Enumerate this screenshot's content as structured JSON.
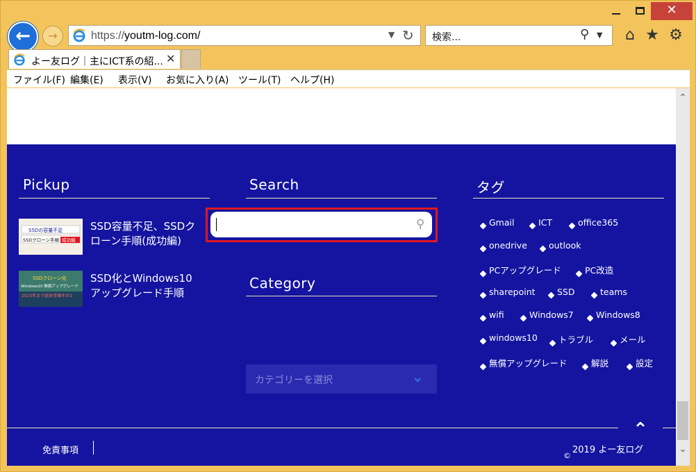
{
  "window": {
    "minimize_icon": "minimize-icon",
    "maximize_icon": "maximize-icon",
    "close_label": "✕"
  },
  "nav": {
    "url_prefix": "https://",
    "url_host": "youtm-log.com/",
    "search_placeholder": "検索...",
    "back_icon": "back-arrow-icon",
    "forward_icon": "forward-arrow-icon"
  },
  "tab": {
    "title": "よー友ログ｜主にICT系の紹...",
    "close": "✕"
  },
  "menu": [
    {
      "label": "ファイル(F)"
    },
    {
      "label": "編集(E)"
    },
    {
      "label": "表示(V)"
    },
    {
      "label": "お気に入り(A)"
    },
    {
      "label": "ツール(T)"
    },
    {
      "label": "ヘルプ(H)"
    }
  ],
  "pickup": {
    "title": "Pickup",
    "posts": [
      {
        "title": "SSD容量不足、SSDク\nローン手順(成功編)",
        "thumb_text1": "SSDの容量不足",
        "thumb_text2": "SSDクローン手順",
        "thumb_badge": "成功編"
      },
      {
        "title": "SSD化とWindows10\nアップグレード手順",
        "thumb_text1": "SSDクローン化",
        "thumb_text2": "Windows10 無償アップグレード",
        "thumb_badge": "2025年まで延命手順その1"
      }
    ]
  },
  "search": {
    "title": "Search",
    "value": ""
  },
  "category": {
    "title": "Category",
    "placeholder": "カテゴリーを選択"
  },
  "tags": {
    "title": "タグ",
    "items": [
      "Gmail",
      "ICT",
      "office365",
      "onedrive",
      "outlook",
      "PCアップグレード",
      "PC改造",
      "sharepoint",
      "SSD",
      "teams",
      "wifi",
      "Windows7",
      "Windows8",
      "windows10",
      "トラブル",
      "メール",
      "無償アップグレード",
      "解説",
      "設定"
    ]
  },
  "footer": {
    "disclaimer": "免責事項",
    "copyright_symbol": "©",
    "copyright": "2019 よー友ログ"
  },
  "colors": {
    "footer_bg": "#1414a0",
    "highlight": "#e0171f",
    "frame": "#f3c45c"
  }
}
